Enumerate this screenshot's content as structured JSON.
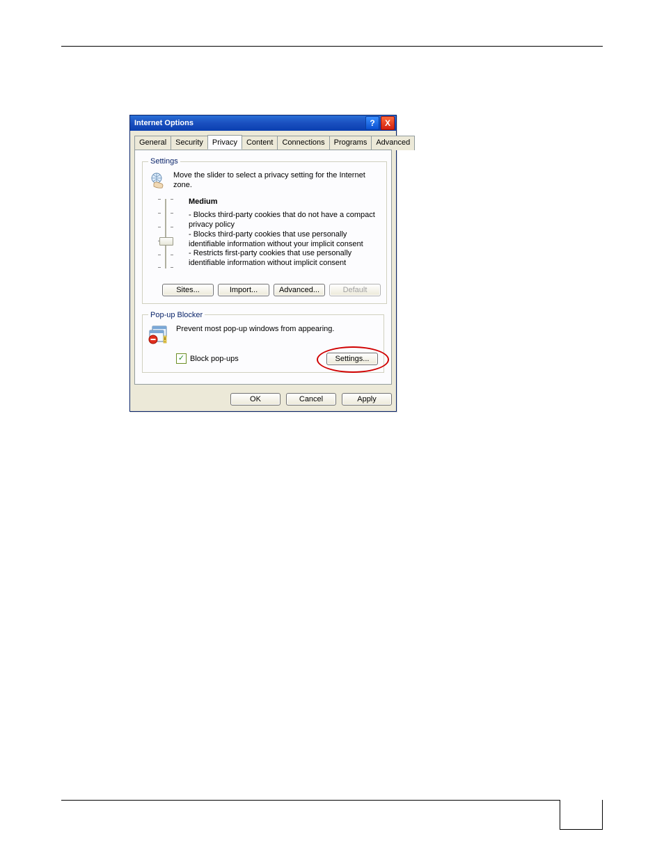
{
  "window": {
    "title": "Internet Options",
    "help_symbol": "?",
    "close_symbol": "X"
  },
  "tabs": {
    "general": "General",
    "security": "Security",
    "privacy": "Privacy",
    "content": "Content",
    "connections": "Connections",
    "programs": "Programs",
    "advanced": "Advanced"
  },
  "settings_group": {
    "legend": "Settings",
    "instruction": "Move the slider to select a privacy setting for the Internet zone.",
    "level_name": "Medium",
    "bullet1": "- Blocks third-party cookies that do not have a compact privacy policy",
    "bullet2": "- Blocks third-party cookies that use personally identifiable information without your implicit consent",
    "bullet3": "- Restricts first-party cookies that use personally identifiable information without implicit consent",
    "buttons": {
      "sites": "Sites...",
      "import": "Import...",
      "advanced": "Advanced...",
      "default": "Default"
    }
  },
  "popup_group": {
    "legend": "Pop-up Blocker",
    "description": "Prevent most pop-up windows from appearing.",
    "checkbox_label": "Block pop-ups",
    "checkbox_checked": true,
    "settings_button": "Settings..."
  },
  "dialog_buttons": {
    "ok": "OK",
    "cancel": "Cancel",
    "apply": "Apply"
  }
}
